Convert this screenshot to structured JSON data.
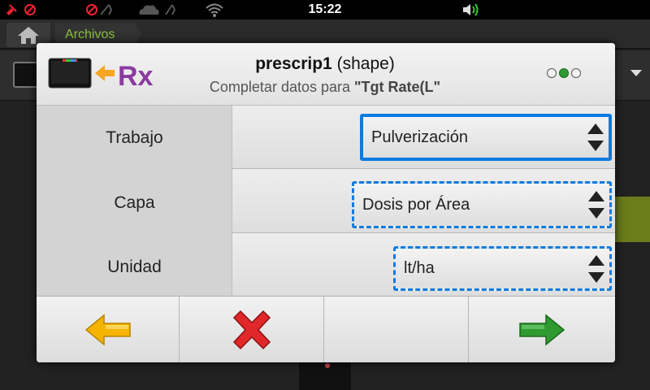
{
  "status_bar": {
    "time": "15:22",
    "icons": [
      "gps-off-icon",
      "no-signal-icon",
      "sync-icon",
      "no-network-icon",
      "sync-icon",
      "cloud-icon",
      "sync-icon",
      "wifi-icon",
      "volume-icon"
    ]
  },
  "background": {
    "breadcrumb": "Archivos"
  },
  "dialog": {
    "title": "prescrip1",
    "title_suffix": "(shape)",
    "subtitle_prefix": "Completar datos para",
    "subtitle_target": "\"Tgt Rate(L\"",
    "page_indicator": {
      "total": 3,
      "current": 2
    },
    "rows": [
      {
        "label": "Trabajo",
        "value": "Pulverización",
        "state": "focused"
      },
      {
        "label": "Capa",
        "value": "Dosis por Área",
        "state": "dashed"
      },
      {
        "label": "Unidad",
        "value": "lt/ha",
        "state": "dashed"
      }
    ],
    "buttons": {
      "back": "left-arrow-icon",
      "cancel": "red-x-icon",
      "empty": "",
      "next": "right-arrow-icon"
    }
  },
  "colors": {
    "accent": "#0a7be0",
    "breadcrumb": "#8dc63f",
    "confirm": "#2e9a30",
    "cancel": "#e0272a",
    "back": "#f5b400"
  }
}
